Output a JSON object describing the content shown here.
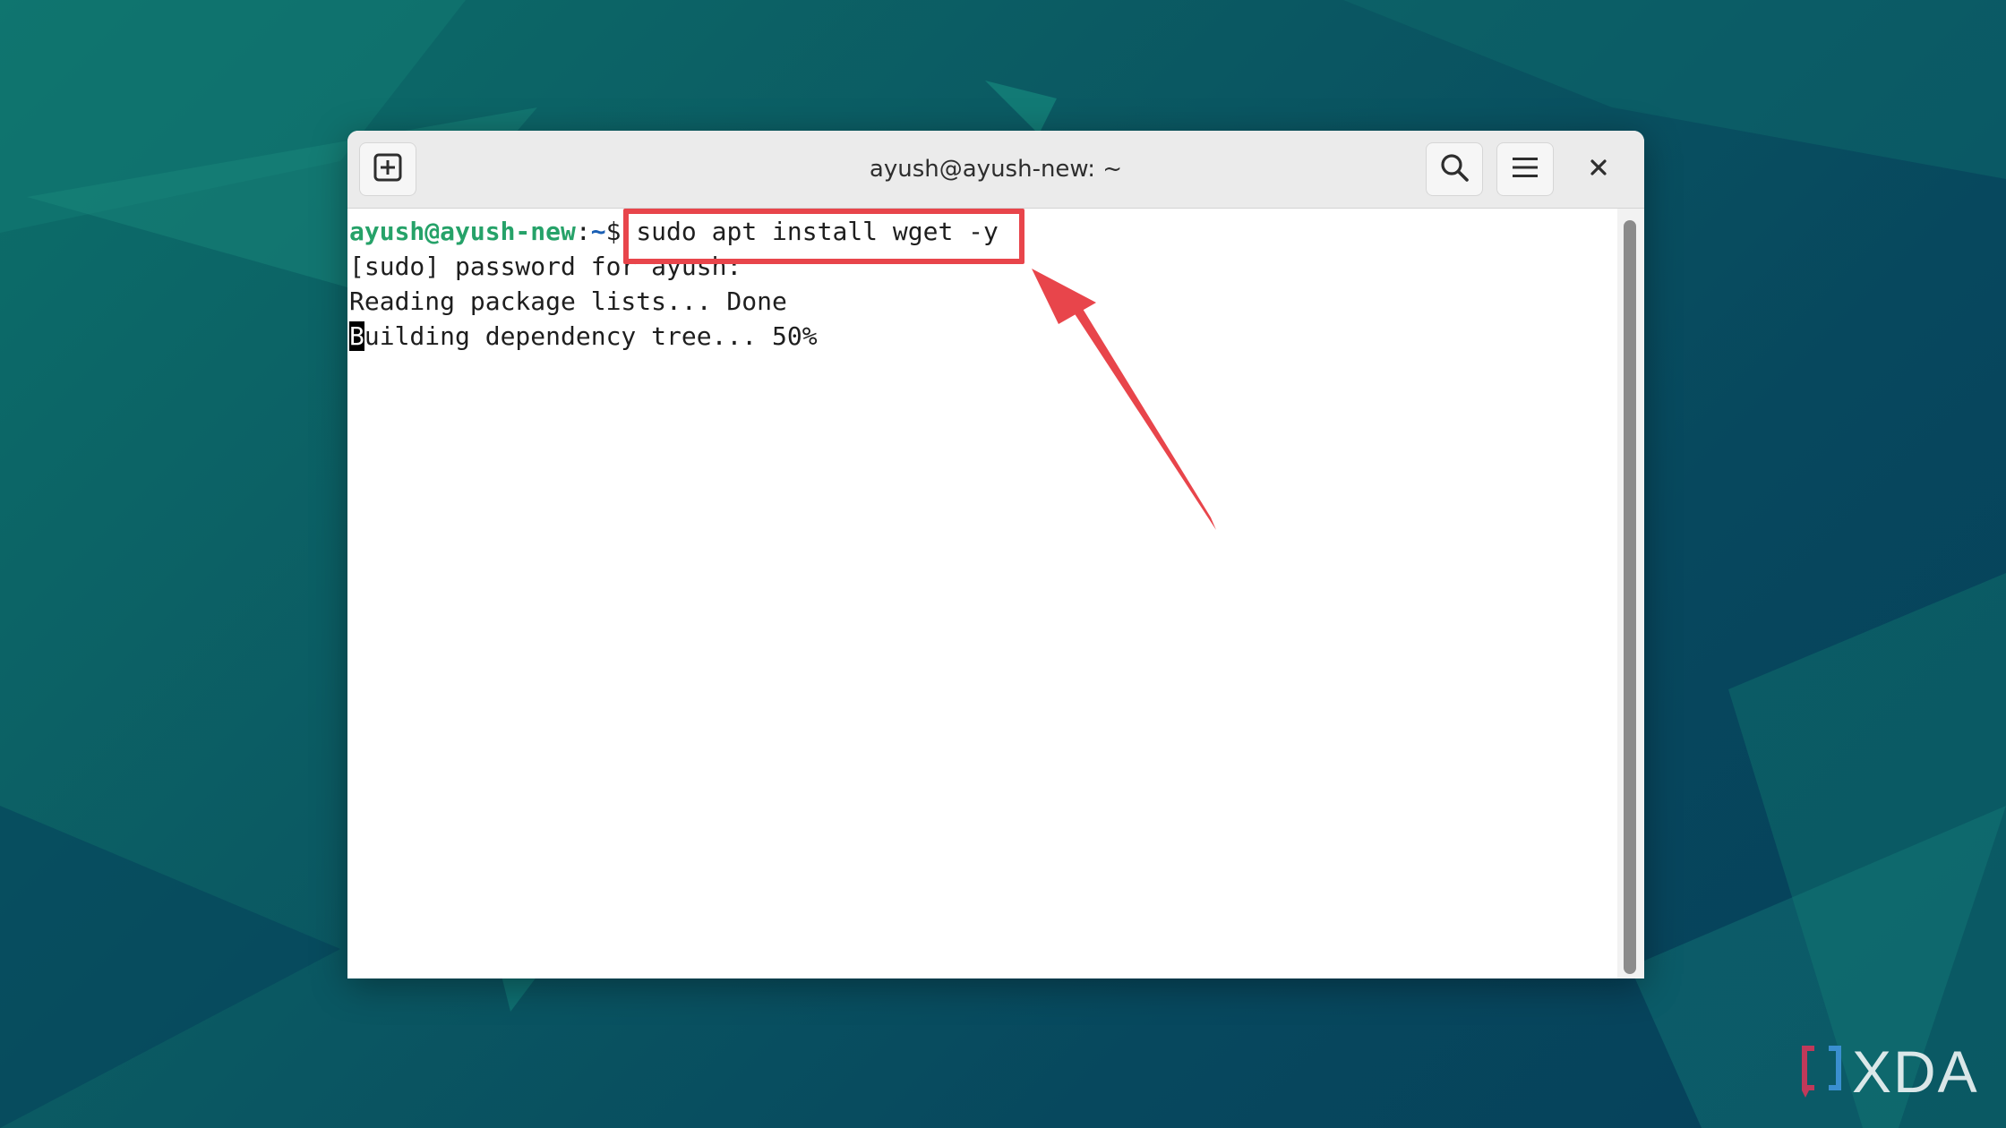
{
  "window": {
    "title": "ayush@ayush-new: ~"
  },
  "titlebar": {
    "new_tab_icon": "new-tab-icon",
    "search_icon": "search-icon",
    "menu_icon": "hamburger-menu-icon",
    "close_icon": "close-icon"
  },
  "terminal": {
    "prompt_user_host": "ayush@ayush-new",
    "prompt_colon": ":",
    "prompt_path": "~",
    "prompt_symbol": "$ ",
    "command": "sudo apt install wget -y",
    "line2": "[sudo] password for ayush:",
    "line3": "Reading package lists... Done",
    "line4_cursor_char": "B",
    "line4_rest": "uilding dependency tree... 50%"
  },
  "annotation": {
    "highlight_color": "#e8454b",
    "arrow_color": "#e8454b"
  },
  "colors": {
    "prompt_user": "#26a269",
    "prompt_path": "#1a5fb4"
  },
  "watermark": {
    "text": "XDA"
  }
}
